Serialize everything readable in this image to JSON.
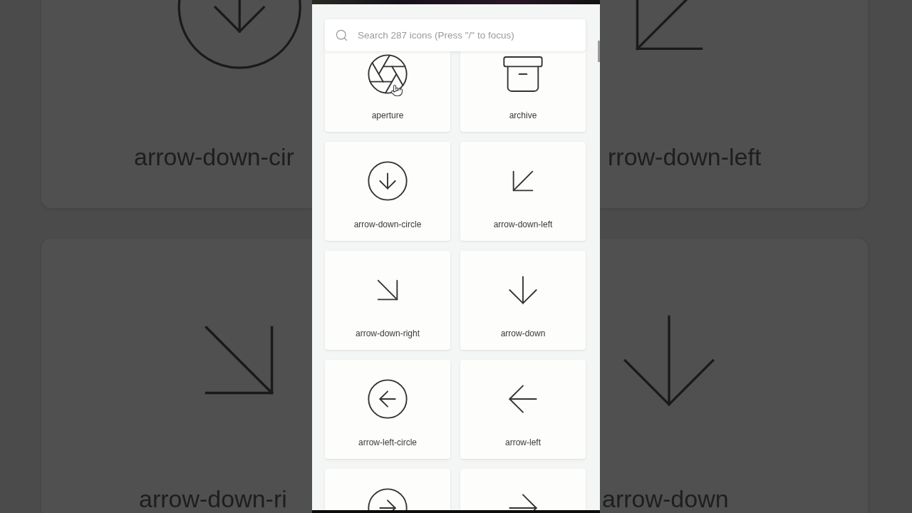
{
  "background": {
    "left_cards": [
      {
        "kind": "arrow-down-circle",
        "label": "arrow-down-cir"
      },
      {
        "kind": "arrow-down-right",
        "label": "arrow-down-ri"
      }
    ],
    "right_cards": [
      {
        "kind": "arrow-down-left",
        "label": "rrow-down-left"
      },
      {
        "kind": "arrow-down",
        "label": "arrow-down"
      }
    ]
  },
  "search": {
    "placeholder": "Search 287 icons (Press \"/\" to focus)"
  },
  "icons": [
    {
      "kind": "aperture",
      "label": "aperture"
    },
    {
      "kind": "archive",
      "label": "archive"
    },
    {
      "kind": "arrow-down-circle",
      "label": "arrow-down-circle"
    },
    {
      "kind": "arrow-down-left",
      "label": "arrow-down-left"
    },
    {
      "kind": "arrow-down-right",
      "label": "arrow-down-right"
    },
    {
      "kind": "arrow-down",
      "label": "arrow-down"
    },
    {
      "kind": "arrow-left-circle",
      "label": "arrow-left-circle"
    },
    {
      "kind": "arrow-left",
      "label": "arrow-left"
    },
    {
      "kind": "arrow-right-circle"
    },
    {
      "kind": "arrow-right"
    }
  ]
}
